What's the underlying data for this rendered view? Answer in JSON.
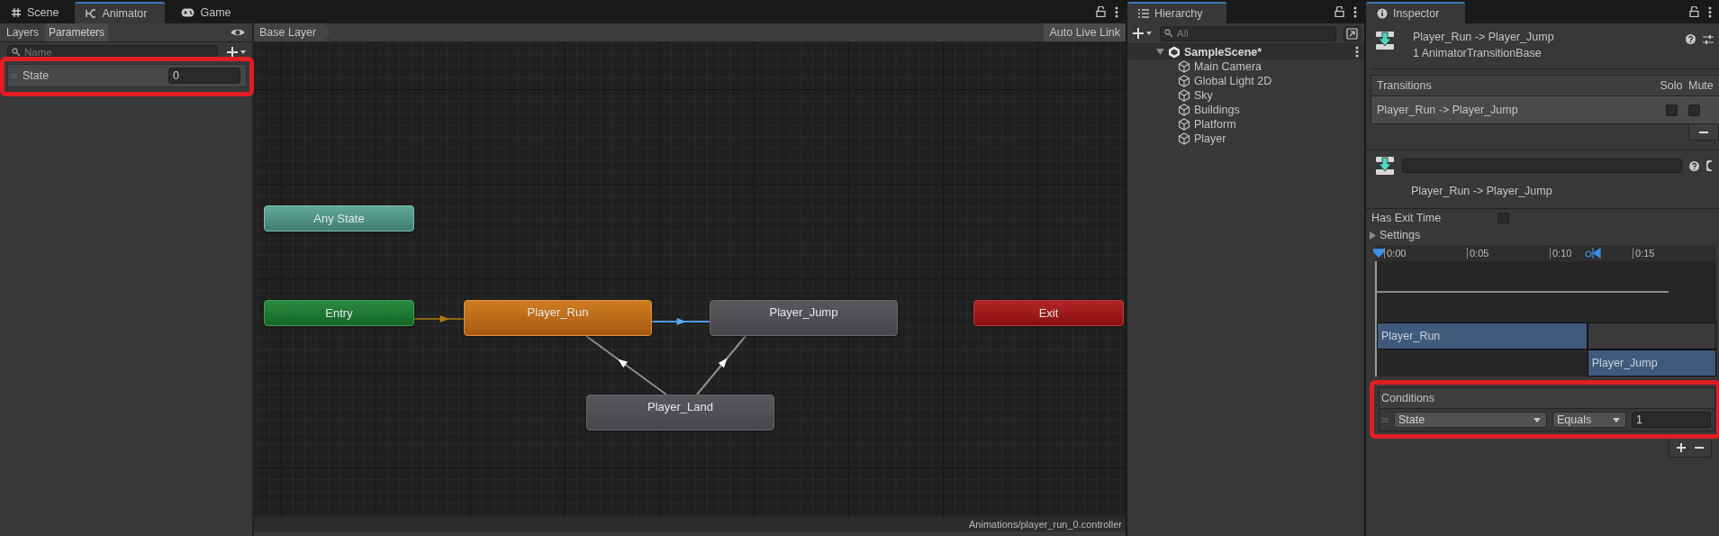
{
  "editor_tabs": [
    {
      "label": "Scene",
      "selected": false
    },
    {
      "label": "Animator",
      "selected": true
    },
    {
      "label": "Game",
      "selected": false
    }
  ],
  "animator": {
    "side_tabs": [
      {
        "label": "Layers",
        "selected": false
      },
      {
        "label": "Parameters",
        "selected": true
      }
    ],
    "search": {
      "placeholder": "Name"
    },
    "parameters": [
      {
        "name": "State",
        "value": "0",
        "highlighted": true
      }
    ],
    "breadcrumb": "Base Layer",
    "live_link": "Auto Live Link",
    "nodes": [
      {
        "label": "Any State",
        "kind": "any"
      },
      {
        "label": "Entry",
        "kind": "entry"
      },
      {
        "label": "Player_Run",
        "kind": "default"
      },
      {
        "label": "Player_Jump",
        "kind": "state"
      },
      {
        "label": "Exit",
        "kind": "exit"
      },
      {
        "label": "Player_Land",
        "kind": "state"
      }
    ],
    "transitions": [
      {
        "kind": "entry",
        "selected": false
      },
      {
        "kind": "state",
        "selected": true
      },
      {
        "kind": "state",
        "selected": false
      },
      {
        "kind": "state",
        "selected": false
      }
    ],
    "path": "Animations/player_run_0.controller"
  },
  "hierarchy": {
    "title": "Hierarchy",
    "search": {
      "placeholder": "All"
    },
    "tree": [
      {
        "label": "SampleScene*",
        "kind": "scene",
        "expanded": true,
        "children": [
          {
            "label": "Main Camera",
            "kind": "object"
          },
          {
            "label": "Global Light 2D",
            "kind": "object"
          },
          {
            "label": "Sky",
            "kind": "object"
          },
          {
            "label": "Buildings",
            "kind": "object"
          },
          {
            "label": "Platform",
            "kind": "object"
          },
          {
            "label": "Player",
            "kind": "object"
          }
        ]
      }
    ]
  },
  "inspector": {
    "title": "Inspector",
    "header": {
      "title": "Player_Run -> Player_Jump",
      "subtitle": "1 AnimatorTransitionBase"
    },
    "transitions_list": {
      "columns": [
        "Transitions",
        "Solo",
        "Mute"
      ],
      "rows": [
        {
          "name": "Player_Run -> Player_Jump",
          "solo": false,
          "mute": false,
          "selected": true
        }
      ]
    },
    "transition_label": "Player_Run -> Player_Jump",
    "has_exit_time": {
      "label": "Has Exit Time",
      "checked": false
    },
    "settings": {
      "label": "Settings",
      "expanded": false
    },
    "timeline": {
      "ticks": [
        "0:00",
        "0:05",
        "0:10",
        "0:15"
      ],
      "clips": [
        {
          "label": "Player_Run"
        },
        {
          "label": "Player_Jump"
        }
      ]
    },
    "conditions": {
      "title": "Conditions",
      "highlighted": true,
      "rows": [
        {
          "parameter": "State",
          "mode": "Equals",
          "value": "1"
        }
      ]
    }
  }
}
